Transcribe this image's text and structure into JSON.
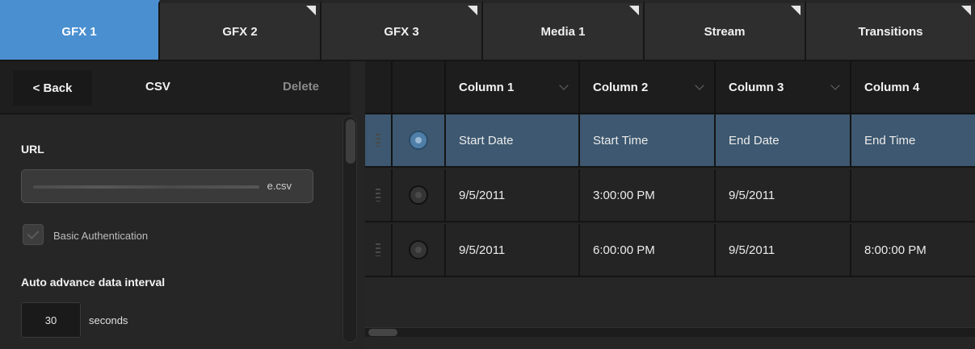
{
  "tabs": [
    {
      "label": "GFX 1",
      "active": true
    },
    {
      "label": "GFX 2"
    },
    {
      "label": "GFX 3"
    },
    {
      "label": "Media 1"
    },
    {
      "label": "Stream"
    },
    {
      "label": "Transitions"
    }
  ],
  "panel": {
    "back_label": "< Back",
    "title": "CSV",
    "delete_label": "Delete",
    "url_label": "URL",
    "url_value": "e.csv",
    "basic_auth_label": "Basic Authentication",
    "interval_label": "Auto advance data interval",
    "interval_value": "30",
    "interval_unit": "seconds"
  },
  "grid": {
    "columns": [
      "Column 1",
      "Column 2",
      "Column 3",
      "Column 4"
    ],
    "rows": [
      [
        "Start Date",
        "Start Time",
        "End Date",
        "End Time"
      ],
      [
        "9/5/2011",
        "3:00:00 PM",
        "9/5/2011",
        ""
      ],
      [
        "9/5/2011",
        "6:00:00 PM",
        "9/5/2011",
        "8:00:00 PM"
      ]
    ],
    "selected_row": 0
  },
  "colors": {
    "active_tab": "#4a8fd0",
    "selected_row": "#3d5870"
  }
}
